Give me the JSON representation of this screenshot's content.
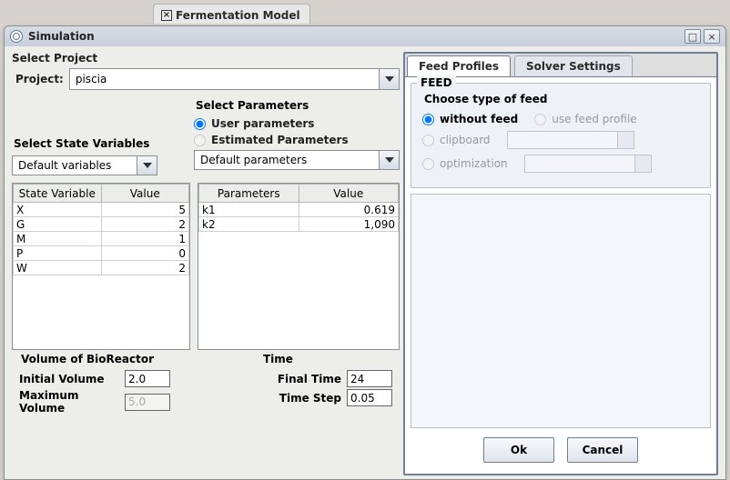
{
  "bgtab": {
    "label": "Fermentation Model"
  },
  "window": {
    "title": "Simulation"
  },
  "project": {
    "section": "Select Project",
    "label": "Project:",
    "value": "piscia"
  },
  "stateVars": {
    "section": "Select State Variables",
    "combo": "Default variables",
    "header1": "State Variable",
    "header2": "Value",
    "rows": [
      {
        "name": "X",
        "value": "5"
      },
      {
        "name": "G",
        "value": "2"
      },
      {
        "name": "M",
        "value": "1"
      },
      {
        "name": "P",
        "value": "0"
      },
      {
        "name": "W",
        "value": "2"
      }
    ]
  },
  "params": {
    "section": "Select Parameters",
    "radio_user": "User parameters",
    "radio_est": "Estimated Parameters",
    "combo": "Default parameters",
    "header1": "Parameters",
    "header2": "Value",
    "rows": [
      {
        "name": "k1",
        "value": "0.619"
      },
      {
        "name": "k2",
        "value": "1,090"
      }
    ]
  },
  "volume": {
    "section": "Volume of BioReactor",
    "initial_l": "Initial Volume",
    "initial_v": "2.0",
    "max_l": "Maximum Volume",
    "max_v": "5.0"
  },
  "time": {
    "section": "Time",
    "final_l": "Final Time",
    "final_v": "24",
    "step_l": "Time Step",
    "step_v": "0.05"
  },
  "tabs": {
    "feed": "Feed Profiles",
    "solver": "Solver Settings"
  },
  "feed": {
    "group": "FEED",
    "choose": "Choose type of feed",
    "without": "without feed",
    "profile": "use feed profile",
    "clipboard": "clipboard",
    "optimization": "optimization"
  },
  "buttons": {
    "ok": "Ok",
    "cancel": "Cancel"
  }
}
